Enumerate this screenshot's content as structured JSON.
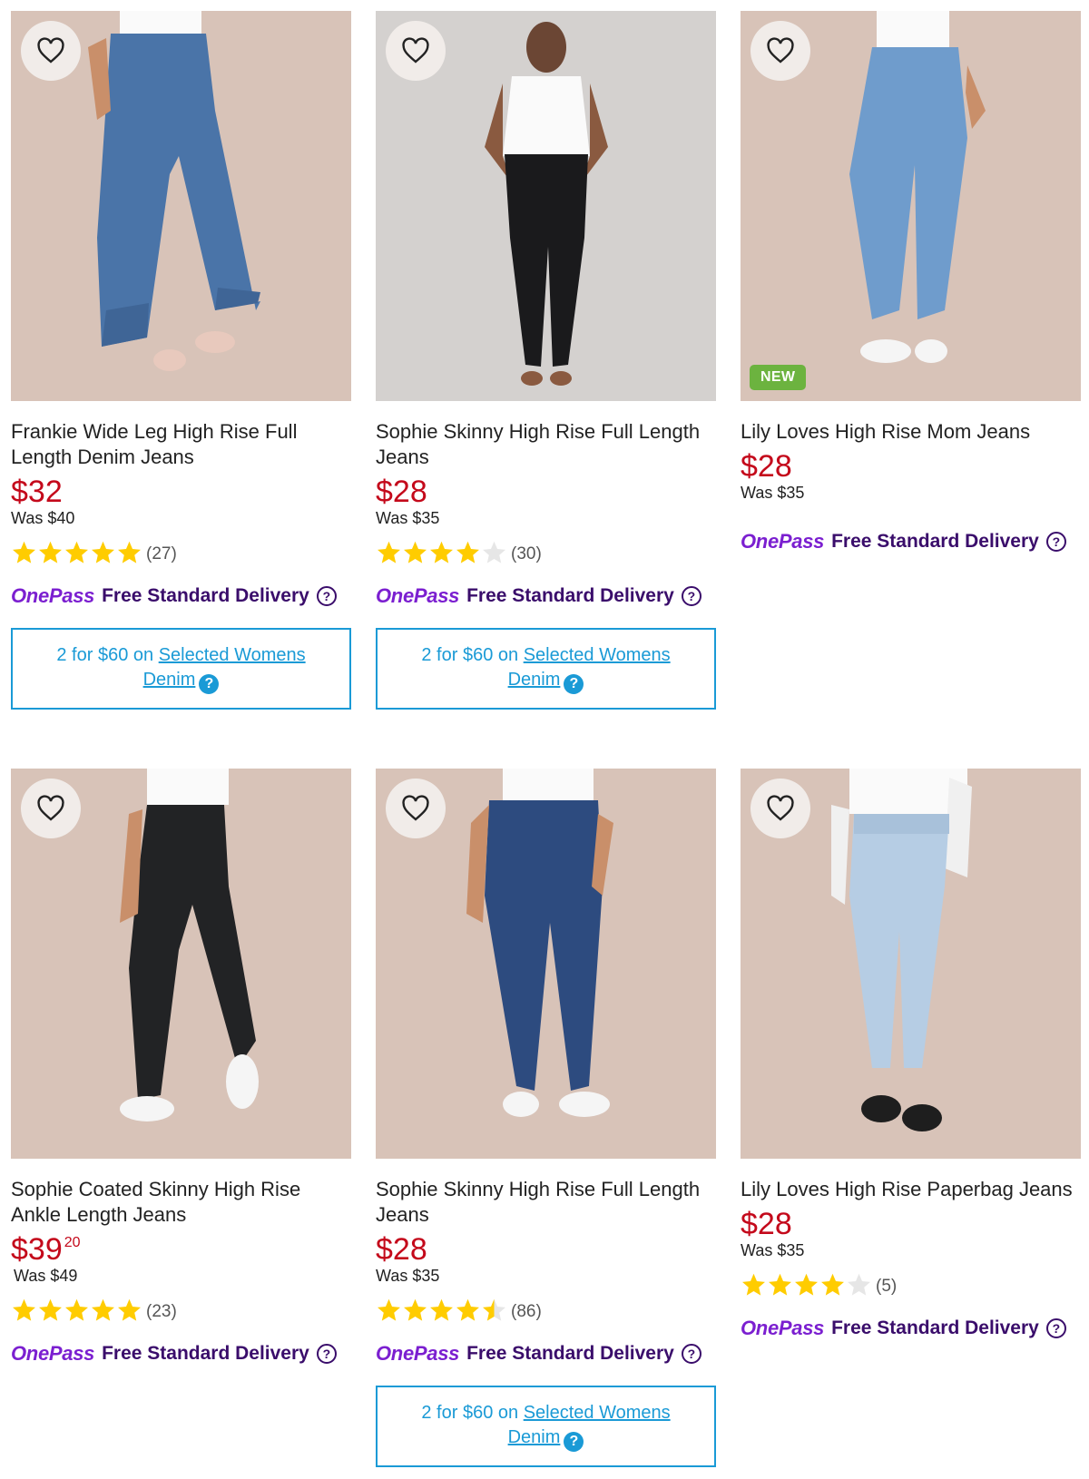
{
  "colors": {
    "price": "#c4091b",
    "star": "#ffcc00",
    "star_empty": "#e6e6e6",
    "onepass_purple": "#7b1fd0",
    "delivery_text": "#3a0d6b",
    "promo_blue": "#1a9ad6",
    "new_badge": "#6cb33f"
  },
  "products": [
    {
      "title": "Frankie Wide Leg High Rise Full Length Denim Jeans",
      "price": "$32",
      "price_cents": "",
      "was": "Was $40",
      "rating": 5,
      "rating_count": "(27)",
      "onepass": "OnePass",
      "delivery": "Free Standard Delivery",
      "promo_prefix": "2 for $60 on ",
      "promo_link": "Selected Womens Denim",
      "badge": "",
      "image": "wide-leg-mid-blue-jeans"
    },
    {
      "title": "Sophie Skinny High Rise Full Length Jeans",
      "price": "$28",
      "price_cents": "",
      "was": "Was $35",
      "rating": 4,
      "rating_count": "(30)",
      "onepass": "OnePass",
      "delivery": "Free Standard Delivery",
      "promo_prefix": "2 for $60 on ",
      "promo_link": "Selected Womens Denim",
      "badge": "",
      "image": "black-skinny-jeans"
    },
    {
      "title": "Lily Loves High Rise Mom Jeans",
      "price": "$28",
      "price_cents": "",
      "was": "Was $35",
      "rating": null,
      "rating_count": "",
      "onepass": "OnePass",
      "delivery": "Free Standard Delivery",
      "promo_prefix": "",
      "promo_link": "",
      "badge": "NEW",
      "image": "light-blue-mom-jeans"
    },
    {
      "title": "Sophie Coated Skinny High Rise Ankle Length Jeans",
      "price": "$39",
      "price_cents": "20",
      "was": "Was $49",
      "rating": 5,
      "rating_count": "(23)",
      "onepass": "OnePass",
      "delivery": "Free Standard Delivery",
      "promo_prefix": "",
      "promo_link": "",
      "badge": "",
      "image": "coated-black-skinny-jeans"
    },
    {
      "title": "Sophie Skinny High Rise Full Length Jeans",
      "price": "$28",
      "price_cents": "",
      "was": "Was $35",
      "rating": 4.5,
      "rating_count": "(86)",
      "onepass": "OnePass",
      "delivery": "Free Standard Delivery",
      "promo_prefix": "2 for $60 on ",
      "promo_link": "Selected Womens Denim",
      "badge": "",
      "image": "dark-blue-skinny-jeans"
    },
    {
      "title": "Lily Loves High Rise Paperbag Jeans",
      "price": "$28",
      "price_cents": "",
      "was": "Was $35",
      "rating": 4,
      "rating_count": "(5)",
      "onepass": "OnePass",
      "delivery": "Free Standard Delivery",
      "promo_prefix": "",
      "promo_link": "",
      "badge": "",
      "image": "light-wash-paperbag-jeans"
    }
  ]
}
